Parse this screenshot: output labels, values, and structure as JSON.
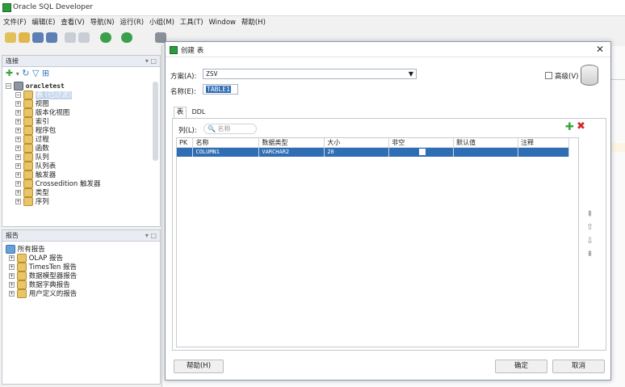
{
  "window": {
    "title": "Oracle SQL Developer"
  },
  "menu": [
    "文件(F)",
    "编辑(E)",
    "查看(V)",
    "导航(N)",
    "运行(R)",
    "小组(M)",
    "工具(T)",
    "Window",
    "帮助(H)"
  ],
  "connections": {
    "title": "连接",
    "root": "oracletest",
    "items": [
      "表 (已过滤)",
      "视图",
      "版本化视图",
      "索引",
      "程序包",
      "过程",
      "函数",
      "队列",
      "队列表",
      "触发器",
      "Crossedition 触发器",
      "类型",
      "序列"
    ]
  },
  "reports": {
    "title": "报告",
    "root": "所有报告",
    "items": [
      "OLAP 报告",
      "TimesTen 报告",
      "数据模型器报告",
      "数据字典报告",
      "用户定义的报告"
    ]
  },
  "dialog": {
    "title": "创建 表",
    "schema_label": "方案(A):",
    "schema_value": "ZSV",
    "name_label": "名称(E):",
    "name_value": "TABLE1",
    "advanced_label": "高级(V)",
    "tabs": [
      "表",
      "DDL"
    ],
    "columns_label": "列(L):",
    "search_placeholder": "名称",
    "headers": [
      "PK",
      "名称",
      "数据类型",
      "大小",
      "非空",
      "默认值",
      "注释"
    ],
    "rows": [
      [
        "",
        "COLUMN1",
        "VARCHAR2",
        "20",
        "",
        "",
        ""
      ]
    ],
    "help_button": "帮助(H)",
    "ok_button": "确定",
    "cancel_button": "取消"
  },
  "colors": {
    "accent": "#2f6db5",
    "add": "#3aa53a",
    "delete": "#d12a2a"
  }
}
